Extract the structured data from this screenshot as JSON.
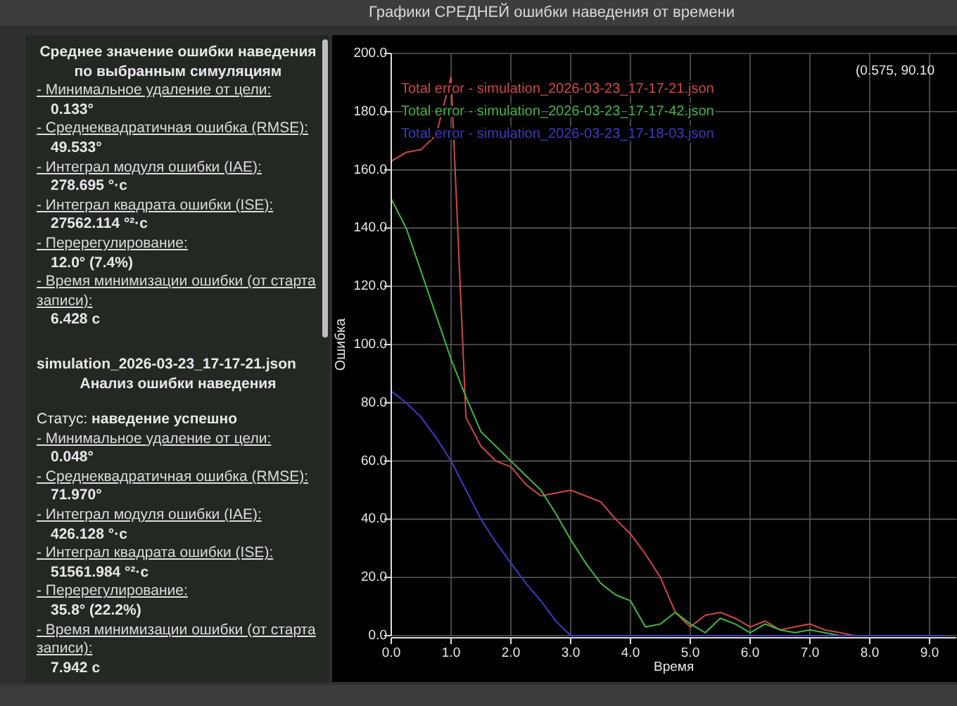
{
  "chart_title": "Графики СРЕДНЕЙ ошибки наведения от времени",
  "summary": {
    "sections": [
      {
        "kind": "average",
        "title": "Среднее значение ошибки наведения по выбранным симуляциям",
        "metrics": [
          {
            "label": "- Минимальное удаление от цели:",
            "value": "0.133°"
          },
          {
            "label": "- Среднеквадратичная ошибка (RMSE):",
            "value": "49.533°"
          },
          {
            "label": "- Интеграл модуля ошибки (IAE):",
            "value": "278.695 °·c"
          },
          {
            "label": "- Интеграл квадрата ошибки (ISE):",
            "value": "27562.114 °²·c"
          },
          {
            "label": "- Перерегулирование:",
            "value": "12.0° (7.4%)"
          },
          {
            "label": "- Время минимизации ошибки (от старта записи):",
            "value": "6.428 c"
          }
        ]
      },
      {
        "kind": "simulation",
        "file": "simulation_2026-03-23_17-17-21.json",
        "title": "Анализ ошибки наведения",
        "status_label": "Статус:",
        "status": "наведение успешно",
        "metrics": [
          {
            "label": "- Минимальное удаление от цели:",
            "value": "0.048°"
          },
          {
            "label": "- Среднеквадратичная ошибка (RMSE):",
            "value": "71.970°"
          },
          {
            "label": "- Интеграл модуля ошибки (IAE):",
            "value": "426.128 °·c"
          },
          {
            "label": "- Интеграл квадрата ошибки (ISE):",
            "value": "51561.984 °²·c"
          },
          {
            "label": "- Перерегулирование:",
            "value": "35.8° (22.2%)"
          },
          {
            "label": "- Время минимизации ошибки (от старта записи):",
            "value": "7.942 c"
          }
        ]
      }
    ]
  },
  "plot": {
    "cursor": "(0.575, 90.10",
    "chart_data": {
      "type": "line",
      "xlabel": "Время",
      "ylabel": "Ошибка",
      "x": [
        0,
        0.25,
        0.5,
        0.75,
        1,
        1.25,
        1.5,
        1.75,
        2,
        2.25,
        2.5,
        2.75,
        3,
        3.25,
        3.5,
        3.75,
        4,
        4.25,
        4.5,
        4.75,
        5,
        5.25,
        5.5,
        5.75,
        6,
        6.25,
        6.5,
        6.75,
        7,
        7.25,
        7.5,
        7.75,
        8,
        8.25,
        8.5,
        8.75,
        9,
        9.25
      ],
      "series": [
        {
          "name": "Total error - simulation_2026-03-23_17-17-21.json",
          "color": "#d04848",
          "values": [
            163,
            166,
            167,
            172,
            192,
            75,
            65,
            60,
            58,
            52,
            48,
            49,
            50,
            48,
            46,
            40,
            35,
            28,
            20,
            8,
            3,
            7,
            8,
            6,
            3,
            5,
            2,
            3,
            4,
            2,
            1,
            0,
            0,
            null,
            null,
            null,
            null,
            null
          ]
        },
        {
          "name": "Total error - simulation_2026-03-23_17-17-42.json",
          "color": "#40b840",
          "values": [
            150,
            140,
            125,
            110,
            95,
            82,
            70,
            65,
            60,
            55,
            50,
            42,
            33,
            25,
            18,
            14,
            12,
            3,
            4,
            8,
            4,
            1,
            6,
            4,
            1,
            4,
            2,
            1,
            2,
            1,
            0,
            0,
            null,
            null,
            null,
            null,
            null,
            null
          ]
        },
        {
          "name": "Total error - simulation_2026-03-23_17-18-03.json",
          "color": "#3c3cc4",
          "values": [
            84,
            80,
            75,
            68,
            60,
            50,
            40,
            32,
            25,
            18,
            12,
            5,
            0,
            0,
            0,
            0,
            0,
            0,
            0,
            0,
            0,
            0,
            0,
            0,
            0,
            0,
            0,
            0,
            0,
            0,
            0,
            0,
            0,
            0,
            0,
            0,
            0,
            0
          ]
        }
      ],
      "grid": true,
      "xlim": [
        0,
        9.45
      ],
      "ylim": [
        0,
        200
      ],
      "xticks": [
        {
          "value": 0,
          "label": "0.0"
        },
        {
          "value": 1,
          "label": "1.0"
        },
        {
          "value": 2,
          "label": "2.0"
        },
        {
          "value": 3,
          "label": "3.0"
        },
        {
          "value": 4,
          "label": "4.0"
        },
        {
          "value": 5,
          "label": "5.0"
        },
        {
          "value": 6,
          "label": "6.0"
        },
        {
          "value": 7,
          "label": "7.0"
        },
        {
          "value": 8,
          "label": "8.0"
        },
        {
          "value": 9,
          "label": "9.0"
        }
      ],
      "yticks": [
        {
          "value": 0,
          "label": "0.0"
        },
        {
          "value": 20,
          "label": "20.0"
        },
        {
          "value": 40,
          "label": "40.0"
        },
        {
          "value": 60,
          "label": "60.0"
        },
        {
          "value": 80,
          "label": "80.0"
        },
        {
          "value": 100,
          "label": "100.0"
        },
        {
          "value": 120,
          "label": "120.0"
        },
        {
          "value": 140,
          "label": "140.0"
        },
        {
          "value": 160,
          "label": "160.0"
        },
        {
          "value": 180,
          "label": "180.0"
        },
        {
          "value": 200,
          "label": "200.0"
        }
      ]
    }
  }
}
